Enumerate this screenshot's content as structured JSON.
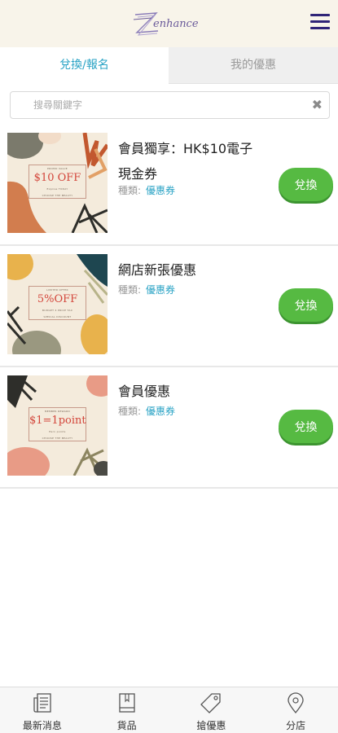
{
  "header": {
    "logo_text": "enhance",
    "menu_icon": "hamburger-menu-icon"
  },
  "tabs": [
    {
      "label": "兌換/報名",
      "active": true
    },
    {
      "label": "我的優惠",
      "active": false
    }
  ],
  "search": {
    "placeholder": "搜尋關鍵字",
    "value": "",
    "clear_icon": "close-icon"
  },
  "coupons": [
    {
      "title": "會員獨享：HK$10電子現金券",
      "category_label": "種類:",
      "category_value": "優惠券",
      "button_label": "兌換",
      "image": {
        "headline": "$10 OFF",
        "top_text": "PROMO VALUE",
        "sub_text": "Expires TODAY",
        "bottom_text": "CHOOSE THE BEAUTY"
      }
    },
    {
      "title": "網店新張優惠",
      "category_label": "種類:",
      "category_value": "優惠券",
      "button_label": "兌換",
      "image": {
        "headline": "5%OFF",
        "top_text": "LIMITED OFFER",
        "sub_text": "BUDGET 4 PRICE TAX",
        "bottom_text": "SPECIAL DISCOUNT"
      }
    },
    {
      "title": "會員優惠",
      "category_label": "種類:",
      "category_value": "優惠券",
      "button_label": "兌換",
      "image": {
        "headline": "$1=1point",
        "top_text": "MEMBER REWARD",
        "sub_text": "Earn points",
        "bottom_text": "CHOOSE THE BEAUTY"
      }
    }
  ],
  "bottom_nav": [
    {
      "label": "最新消息",
      "icon": "news-icon"
    },
    {
      "label": "貨品",
      "icon": "book-icon"
    },
    {
      "label": "搶優惠",
      "icon": "tag-icon"
    },
    {
      "label": "分店",
      "icon": "location-pin-icon"
    }
  ],
  "colors": {
    "accent": "#2aa3c5",
    "button": "#56ba42",
    "brand": "#2f2478",
    "header_bg": "#f8f4ea"
  }
}
